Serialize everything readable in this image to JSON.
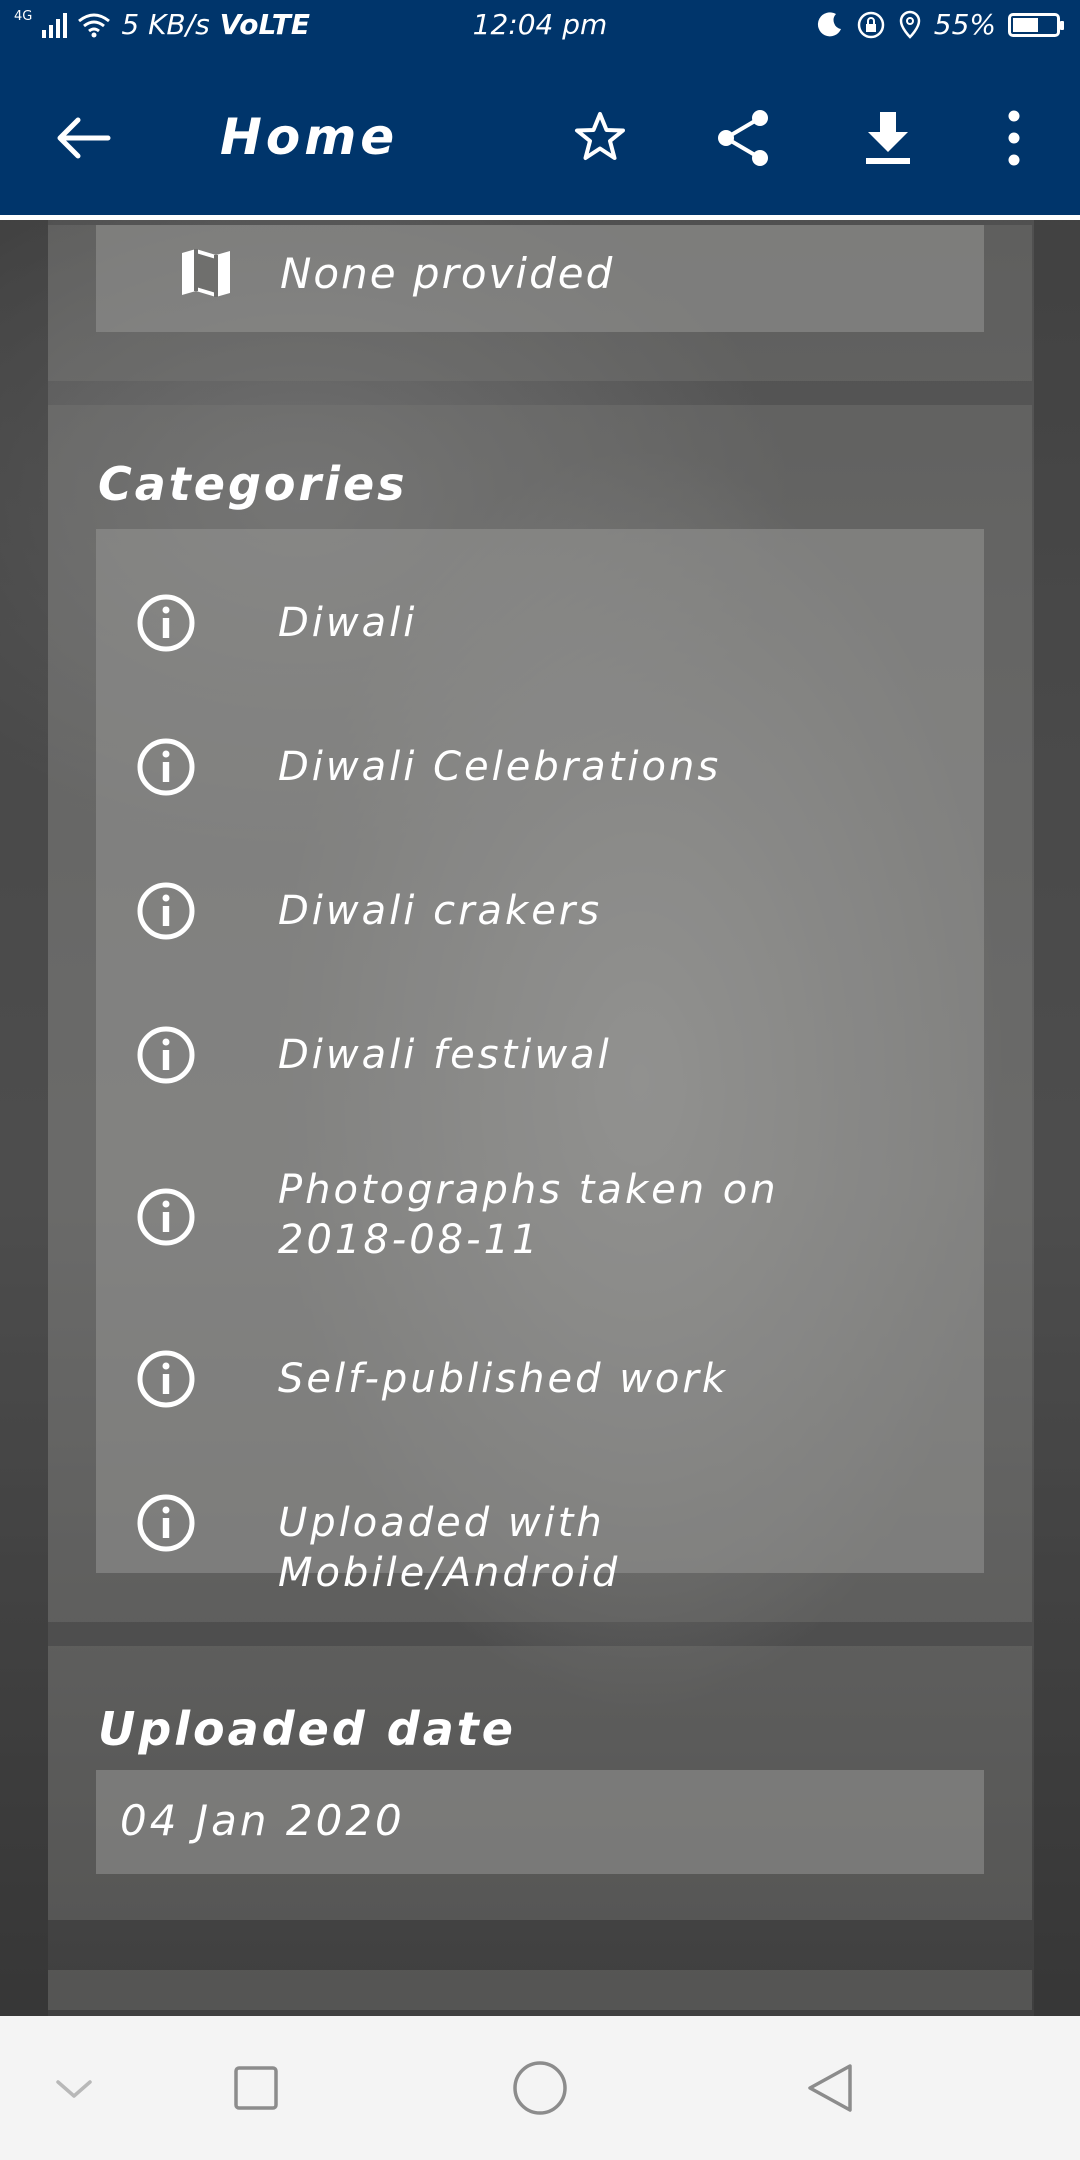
{
  "status_bar": {
    "network": "4G",
    "speed": "5 KB/s",
    "volte": "VoLTE",
    "time": "12:04 pm",
    "battery": "55%",
    "battery_level": 0.55
  },
  "app_bar": {
    "title": "Home",
    "back_icon": "arrow-left-icon",
    "actions": [
      "star-outline-icon",
      "share-icon",
      "download-icon",
      "more-vert-icon"
    ]
  },
  "location_card": {
    "icon": "map-icon",
    "text": "None provided"
  },
  "categories_card": {
    "title": "Categories",
    "items": [
      {
        "label": "Diwali"
      },
      {
        "label": "Diwali Celebrations"
      },
      {
        "label": "Diwali crakers"
      },
      {
        "label": "Diwali festiwal"
      },
      {
        "label": "Photographs taken on 2018-08-11"
      },
      {
        "label": "Self-published work"
      },
      {
        "label": "Uploaded with Mobile/Android"
      }
    ]
  },
  "uploaded_date_card": {
    "title": "Uploaded date",
    "value": "04 Jan 2020"
  },
  "nav_bar": {
    "buttons": [
      "chevron-down-icon",
      "recents-square-icon",
      "home-circle-icon",
      "back-triangle-icon"
    ]
  },
  "colors": {
    "primary": "#00356b",
    "nav_bar": "#f4f4f4"
  }
}
